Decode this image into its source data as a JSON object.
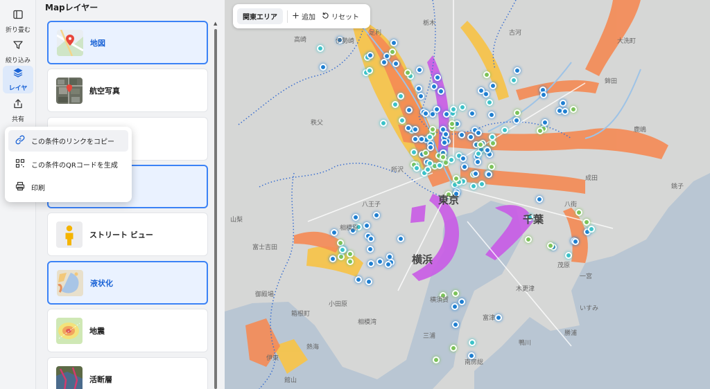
{
  "rail": [
    {
      "label": "折り畳む",
      "icon": "sidebar-collapse-icon"
    },
    {
      "label": "絞り込み",
      "icon": "filter-icon"
    },
    {
      "label": "レイヤ",
      "icon": "layers-icon"
    },
    {
      "label": "共有",
      "icon": "share-icon"
    }
  ],
  "panel": {
    "title": "Mapレイヤー",
    "layers": [
      {
        "label": "地図",
        "selected": true
      },
      {
        "label": "航空写真",
        "selected": false
      },
      {
        "label": "",
        "selected": false
      },
      {
        "label": "",
        "selected": true
      },
      {
        "label": "ストリート ビュー",
        "selected": false
      },
      {
        "label": "液状化",
        "selected": true
      },
      {
        "label": "地震",
        "selected": false
      },
      {
        "label": "活断層",
        "selected": false
      }
    ]
  },
  "toolbar": {
    "area": "関東エリア",
    "add": "追加",
    "reset": "リセット"
  },
  "share_menu": [
    {
      "label": "この条件のリンクをコピー",
      "icon": "link-icon"
    },
    {
      "label": "この条件のQRコードを生成",
      "icon": "qr-code-icon"
    },
    {
      "label": "印刷",
      "icon": "printer-icon"
    }
  ],
  "map": {
    "places": [
      "足利",
      "伊勢崎",
      "栃木",
      "高崎",
      "古河",
      "大洗町",
      "鉾田",
      "秩父",
      "鹿嶋",
      "所沢",
      "八王子",
      "相模原",
      "東京",
      "千葉",
      "八街",
      "富士吉田",
      "山梨",
      "横浜",
      "横須賀",
      "成田",
      "館山",
      "小田原",
      "箱根町",
      "御殿場",
      "木更津",
      "いすみ",
      "一宮",
      "相模湾",
      "熱海",
      "三浦",
      "南房総",
      "鴨川",
      "勝浦",
      "伊東",
      "富津",
      "茂原",
      "銚子"
    ]
  },
  "colors": {
    "accent": "#1a63d6",
    "selected_border": "#3b82f6",
    "hazard_orange": "#f58a54",
    "hazard_purple": "#c95be6",
    "hazard_yellow": "#f6c44c",
    "marker_blue": "#1f7fd1",
    "marker_teal": "#3cc2c8",
    "marker_green": "#7cc35a",
    "sea": "#b9c6d3",
    "land": "#d6d7d6"
  }
}
